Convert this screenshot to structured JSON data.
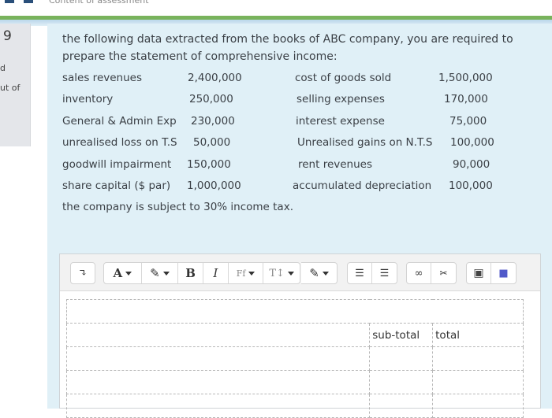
{
  "header": {
    "breadcrumb": "Content of assessment"
  },
  "question_info": {
    "number": "9",
    "line1": "d",
    "line2": "ut of"
  },
  "question": {
    "intro_line1": "the following data extracted from the books of ABC company, you are required to",
    "intro_line2": "prepare the statement of comprehensive income:",
    "left_items": [
      {
        "label": "sales revenues",
        "value": "2,400,000"
      },
      {
        "label": "inventory",
        "value": "250,000"
      },
      {
        "label": "General & Admin Exp",
        "value": "230,000"
      },
      {
        "label": "unrealised loss on T.S",
        "value": "50,000"
      },
      {
        "label": "goodwill impairment",
        "value": "150,000"
      },
      {
        "label": "share capital ($ par)",
        "value": "1,000,000"
      }
    ],
    "right_items": [
      {
        "label": "cost of goods sold",
        "value": "1,500,000"
      },
      {
        "label": "selling expenses",
        "value": "170,000"
      },
      {
        "label": "interest expense",
        "value": "75,000"
      },
      {
        "label": "Unrealised gains on N.T.S",
        "value": "100,000"
      },
      {
        "label": "rent revenues",
        "value": "90,000"
      },
      {
        "label": "accumulated depreciation",
        "value": "100,000"
      }
    ],
    "tax_note": "the company is subject to 30% income tax."
  },
  "editor": {
    "toolbar": {
      "collapse": "↴",
      "font_color": "A",
      "highlight": "✎",
      "bold": "B",
      "italic": "I",
      "font_family": "Ff",
      "font_size": "T↕",
      "paint": "✎",
      "unordered_list": "☰",
      "ordered_list": "☰",
      "link": "∞",
      "unlink": "✂",
      "image": "▣",
      "teams": "■"
    },
    "table": {
      "headers": [
        "",
        "sub-total",
        "total"
      ],
      "rows": [
        [
          "",
          "",
          ""
        ],
        [
          "",
          "",
          ""
        ],
        [
          "",
          "",
          ""
        ]
      ]
    }
  },
  "colors": {
    "accent_green": "#79b35c",
    "panel_blue": "#e0f0f7",
    "teams_purple": "#5059c9"
  }
}
